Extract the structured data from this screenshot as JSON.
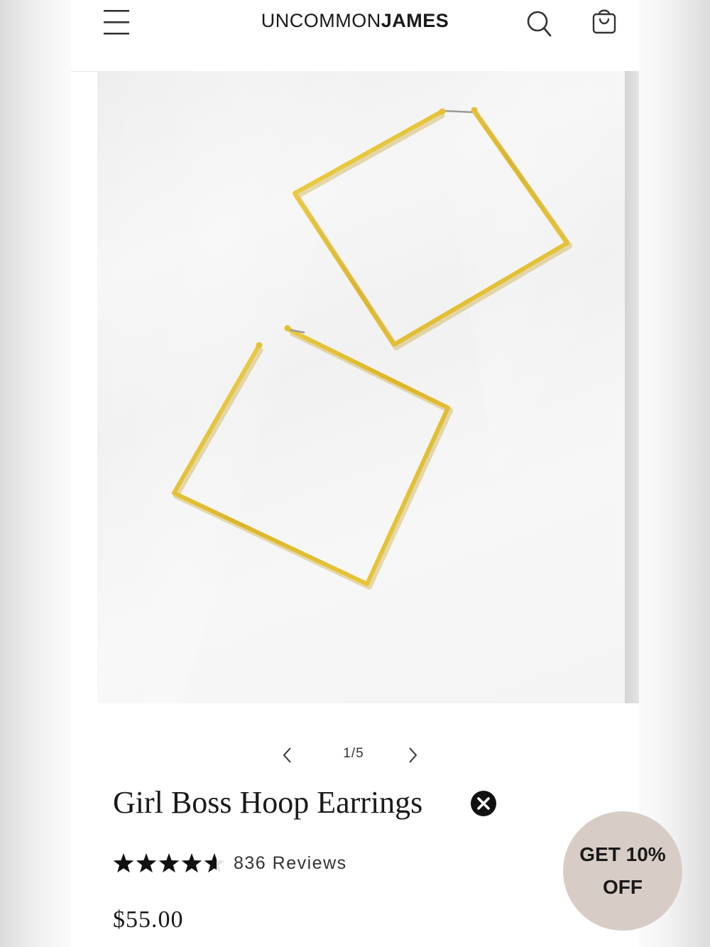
{
  "header": {
    "logo_light": "UNCOMMON",
    "logo_bold": "JAMES",
    "icons": [
      "menu-icon",
      "search-icon",
      "shopping-bag-icon"
    ]
  },
  "gallery": {
    "current": "1",
    "total": "5",
    "counter": "1/5"
  },
  "product": {
    "title": "Girl Boss Hoop Earrings",
    "rating": 4.6,
    "rating_max": 5,
    "reviews": "836 Reviews",
    "price": "$55.00"
  },
  "promo": {
    "label": "GET 10% OFF"
  },
  "colors": {
    "gold": "#e3c133",
    "promo_bg": "#d8cdc6",
    "text": "#1a1a1a"
  }
}
